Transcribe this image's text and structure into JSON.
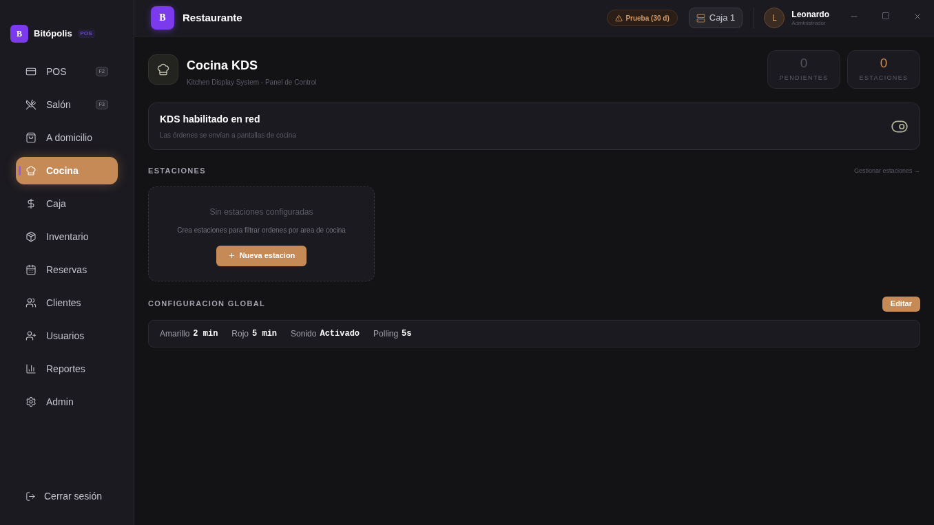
{
  "brand": {
    "initial": "B",
    "name": "Bitópolis",
    "badge": "POS"
  },
  "sidebar": {
    "items": [
      {
        "label": "POS",
        "shortcut": "F2",
        "selected": false
      },
      {
        "label": "Salón",
        "shortcut": "F3",
        "selected": false
      },
      {
        "label": "A domicilio",
        "selected": false
      },
      {
        "label": "Cocina",
        "selected": true
      },
      {
        "label": "Caja",
        "selected": false
      },
      {
        "label": "Inventario",
        "selected": false
      },
      {
        "label": "Reservas",
        "selected": false
      },
      {
        "label": "Clientes",
        "selected": false
      },
      {
        "label": "Usuarios",
        "selected": false
      },
      {
        "label": "Reportes",
        "selected": false
      },
      {
        "label": "Admin",
        "selected": false
      }
    ],
    "logout": "Cerrar sesión"
  },
  "header": {
    "logo_initial": "B",
    "title": "Restaurante",
    "trial": "Prueba (30 d)",
    "register": "Caja 1",
    "user": {
      "initial": "L",
      "name": "Leonardo",
      "role": "Administrador"
    }
  },
  "page": {
    "title": "Cocina KDS",
    "subtitle": "Kitchen Display System - Panel de Control",
    "stats": [
      {
        "value": "0",
        "label": "PENDIENTES",
        "highlight": false
      },
      {
        "value": "0",
        "label": "ESTACIONES",
        "highlight": true
      }
    ]
  },
  "kds_card": {
    "title": "KDS habilitado en red",
    "description": "Las órdenes se envían a pantallas de cocina",
    "on": true
  },
  "stations": {
    "heading": "ESTACIONES",
    "manage_link": "Gestionar estaciones →",
    "empty_title": "Sin estaciones configuradas",
    "empty_text": "Crea estaciones para filtrar ordenes por area de cocina",
    "new_button": "Nueva estacion"
  },
  "global_config": {
    "heading": "CONFIGURACION GLOBAL",
    "edit_button": "Editar",
    "settings": [
      {
        "label": "Amarillo",
        "value": "2 min"
      },
      {
        "label": "Rojo",
        "value": "5 min"
      },
      {
        "label": "Sonido",
        "value": "Activado"
      },
      {
        "label": "Polling",
        "value": "5s"
      }
    ]
  }
}
